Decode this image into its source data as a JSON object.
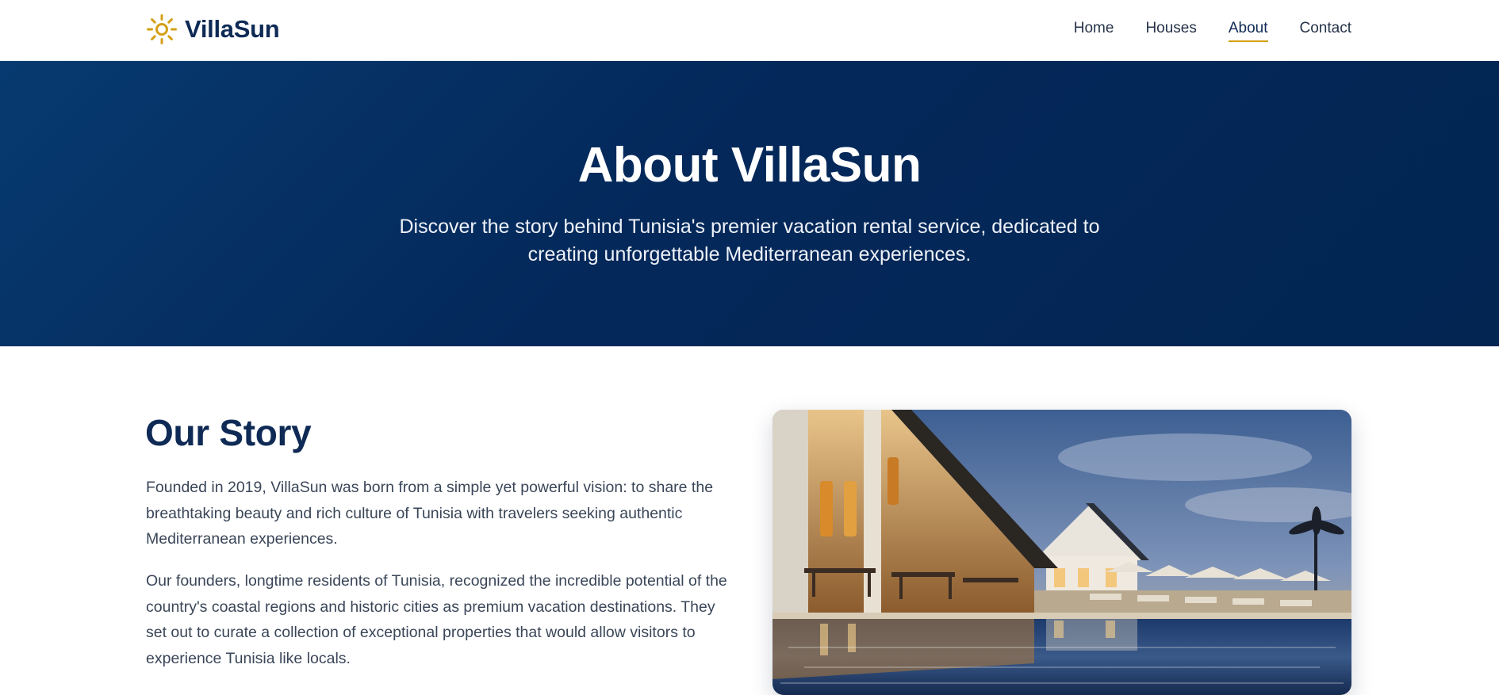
{
  "header": {
    "logo_text": "VillaSun",
    "logo_icon": "sun-icon",
    "nav": [
      {
        "label": "Home",
        "active": false
      },
      {
        "label": "Houses",
        "active": false
      },
      {
        "label": "About",
        "active": true
      },
      {
        "label": "Contact",
        "active": false
      }
    ]
  },
  "hero": {
    "title": "About VillaSun",
    "subtitle": "Discover the story behind Tunisia's premier vacation rental service, dedicated to creating unforgettable Mediterranean experiences."
  },
  "story": {
    "title": "Our Story",
    "paragraphs": [
      "Founded in 2019, VillaSun was born from a simple yet powerful vision: to share the breathtaking beauty and rich culture of Tunisia with travelers seeking authentic Mediterranean experiences.",
      "Our founders, longtime residents of Tunisia, recognized the incredible potential of the country's coastal regions and historic cities as premium vacation destinations. They set out to curate a collection of exceptional properties that would allow visitors to experience Tunisia like locals."
    ]
  },
  "colors": {
    "brand_navy": "#0e2a55",
    "accent_gold": "#d4a017",
    "hero_bg": "#04285a"
  }
}
